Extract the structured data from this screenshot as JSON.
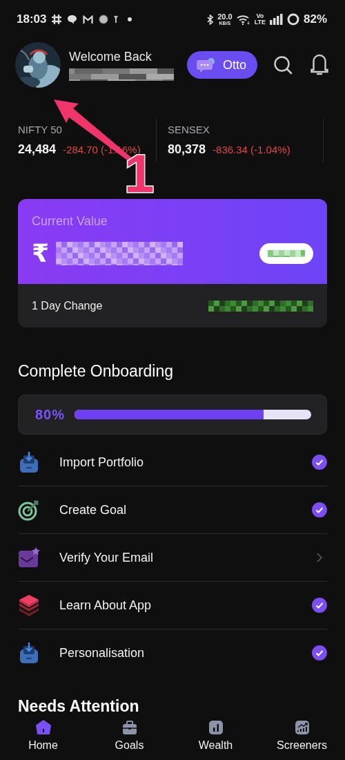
{
  "status_bar": {
    "time": "18:03",
    "speed": "20.0",
    "speed_unit": "KB/S",
    "network_top": "Vo",
    "network_bottom": "LTE",
    "battery": "82%"
  },
  "header": {
    "greeting": "Welcome Back",
    "assistant_button": "Otto"
  },
  "indices": [
    {
      "name": "NIFTY 50",
      "value": "24,484",
      "change": "-284.70 (-1.16%)"
    },
    {
      "name": "SENSEX",
      "value": "80,378",
      "change": "-836.34 (-1.04%)"
    }
  ],
  "value_card": {
    "title": "Current Value",
    "currency": "₹",
    "change_label": "1 Day Change"
  },
  "onboarding": {
    "title": "Complete Onboarding",
    "percent": "80%",
    "level": 0.8,
    "items": [
      {
        "kind": "tray",
        "label": "Import Portfolio",
        "checked": true
      },
      {
        "kind": "target",
        "label": "Create Goal",
        "checked": true
      },
      {
        "kind": "mail",
        "label": "Verify Your Email",
        "checked": false
      },
      {
        "kind": "layers",
        "label": "Learn About App",
        "checked": true
      },
      {
        "kind": "tray",
        "label": "Personalisation",
        "checked": true
      }
    ]
  },
  "next_section": {
    "title": "Needs Attention"
  },
  "nav": [
    {
      "kind": "home",
      "label": "Home",
      "selected": true
    },
    {
      "kind": "briefcase",
      "label": "Goals",
      "selected": false
    },
    {
      "kind": "chart",
      "label": "Wealth",
      "selected": false
    },
    {
      "kind": "trend",
      "label": "Screeners",
      "selected": false
    }
  ],
  "annotation": {
    "number": "1"
  }
}
